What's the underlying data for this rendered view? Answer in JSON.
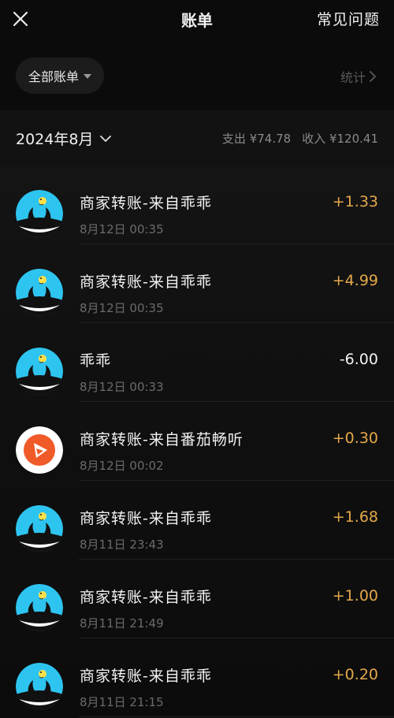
{
  "header": {
    "title": "账单",
    "faq_label": "常见问题",
    "close_icon": "close-icon"
  },
  "filter": {
    "label": "全部账单",
    "stats_label": "统计"
  },
  "month": {
    "label": "2024年8月",
    "expense": "支出 ¥74.78",
    "income": "收入 ¥120.41"
  },
  "colors": {
    "income": "#e4a84a",
    "expense": "#f2f2f2",
    "background": "#0b0b0b"
  },
  "transactions": [
    {
      "name": "商家转账-来自乖乖",
      "time": "8月12日 00:35",
      "amount": "+1.33",
      "type": "income",
      "avatar": "guaiguai-avatar"
    },
    {
      "name": "商家转账-来自乖乖",
      "time": "8月12日 00:35",
      "amount": "+4.99",
      "type": "income",
      "avatar": "guaiguai-avatar"
    },
    {
      "name": "乖乖",
      "time": "8月12日 00:33",
      "amount": "-6.00",
      "type": "expense",
      "avatar": "guaiguai-avatar"
    },
    {
      "name": "商家转账-来自番茄畅听",
      "time": "8月12日 00:02",
      "amount": "+0.30",
      "type": "income",
      "avatar": "fanqie-avatar"
    },
    {
      "name": "商家转账-来自乖乖",
      "time": "8月11日 23:43",
      "amount": "+1.68",
      "type": "income",
      "avatar": "guaiguai-avatar"
    },
    {
      "name": "商家转账-来自乖乖",
      "time": "8月11日 21:49",
      "amount": "+1.00",
      "type": "income",
      "avatar": "guaiguai-avatar"
    },
    {
      "name": "商家转账-来自乖乖",
      "time": "8月11日 21:15",
      "amount": "+0.20",
      "type": "income",
      "avatar": "guaiguai-avatar"
    }
  ]
}
